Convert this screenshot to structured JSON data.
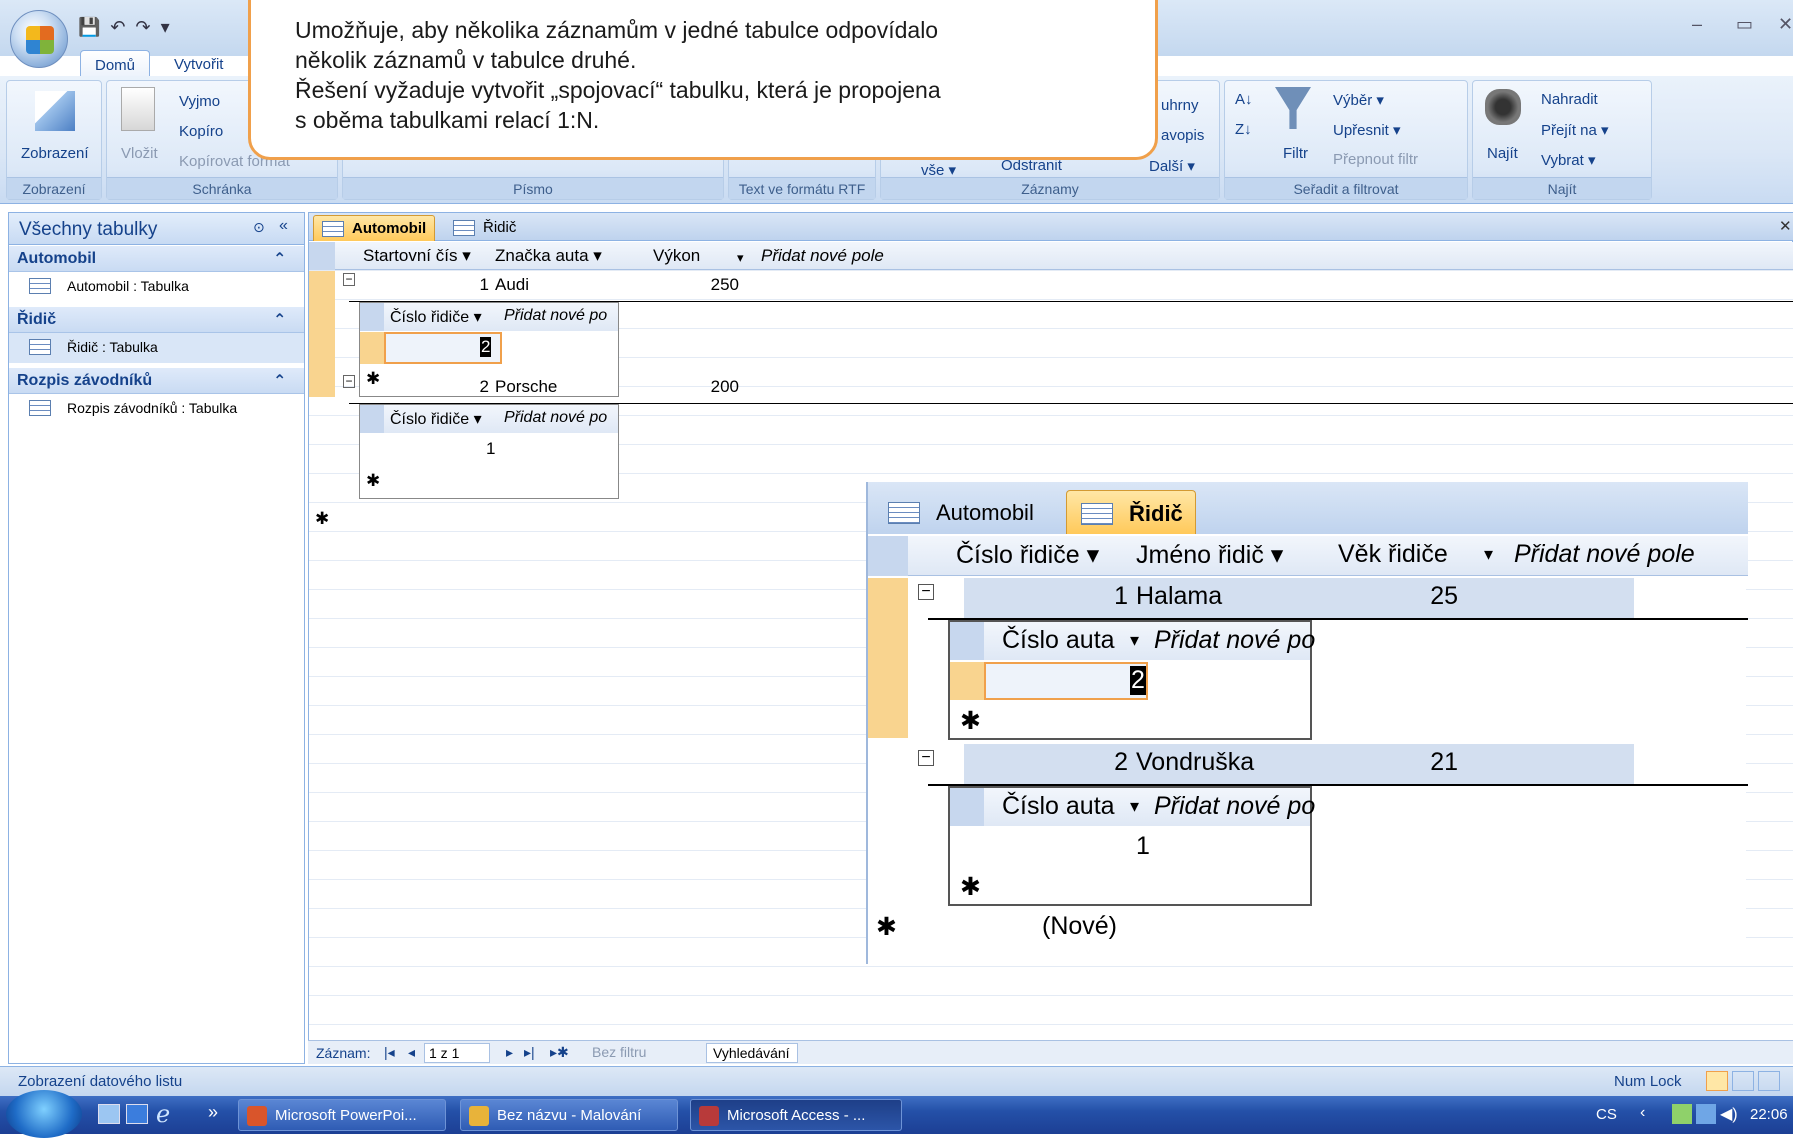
{
  "window": {
    "minimize": "–",
    "restore": "▭",
    "close": "✕"
  },
  "ribbon": {
    "tabs": [
      "Domů",
      "Vytvořit"
    ],
    "groups": {
      "zobrazeni": {
        "button": "Zobrazení",
        "label": "Zobrazení"
      },
      "schranka": {
        "paste": "Vložit",
        "cut": "Vyjmo",
        "copy": "Kopíro",
        "format_painter": "Kopírovat formát",
        "label": "Schránka"
      },
      "pismo": {
        "label": "Písmo"
      },
      "rtf": {
        "label": "Text ve formátu RTF"
      },
      "zaznamy": {
        "totals": "uhrny",
        "spelling": "avopis",
        "delete": "Odstranit",
        "more": "Další ▾",
        "all": "vše ▾",
        "label": "Záznamy"
      },
      "razeni": {
        "filter": "Filtr",
        "selection": "Výběr ▾",
        "advanced": "Upřesnit ▾",
        "toggle": "Přepnout filtr",
        "label": "Seřadit a filtrovat"
      },
      "najit": {
        "find": "Najít",
        "replace": "Nahradit",
        "goto": "Přejít na ▾",
        "select": "Vybrat ▾",
        "label": "Najít"
      }
    }
  },
  "callout": {
    "lines": [
      "Umožňuje, aby několika záznamům v jedné tabulce odpovídalo",
      "několik záznamů v tabulce druhé.",
      "Řešení vyžaduje vytvořit „spojovací“ tabulku, která je propojena",
      "s oběma tabulkami relací 1:N."
    ]
  },
  "nav_pane": {
    "title": "Všechny tabulky",
    "groups": [
      {
        "name": "Automobil",
        "item": "Automobil : Tabulka"
      },
      {
        "name": "Řidič",
        "item": "Řidič : Tabulka"
      },
      {
        "name": "Rozpis závodníků",
        "item": "Rozpis závodníků : Tabulka"
      }
    ]
  },
  "doc": {
    "tabs": [
      "Automobil",
      "Řidič"
    ],
    "headers": [
      "Startovní čís ▾",
      "Značka auta ▾",
      "Výkon",
      "▾",
      "Přidat nové pole"
    ],
    "rows": [
      {
        "id": "1",
        "brand": "Audi",
        "power": "250",
        "sub_header": [
          "Číslo řidiče ▾",
          "Přidat nové po"
        ],
        "sub_value": "2"
      },
      {
        "id": "2",
        "brand": "Porsche",
        "power": "200",
        "sub_header": [
          "Číslo řidiče ▾",
          "Přidat nové po"
        ],
        "sub_value": "1"
      }
    ],
    "new_row_marker": "✱"
  },
  "zoom": {
    "tabs": [
      "Automobil",
      "Řidič"
    ],
    "headers": [
      "Číslo řidiče ▾",
      "Jméno řidič ▾",
      "Věk řidiče",
      "▾",
      "Přidat nové pole"
    ],
    "rows": [
      {
        "id": "1",
        "name": "Halama",
        "age": "25",
        "sub_header": [
          "Číslo auta",
          "▾",
          "Přidat nové po"
        ],
        "sub_value": "2"
      },
      {
        "id": "2",
        "name": "Vondruška",
        "age": "21",
        "sub_header": [
          "Číslo auta",
          "▾",
          "Přidat nové po"
        ],
        "sub_value": "1"
      }
    ],
    "new_label": "(Nové)",
    "new_row_marker": "✱"
  },
  "record_nav": {
    "label": "Záznam:",
    "position": "1 z 1",
    "filter": "Bez filtru",
    "search": "Vyhledávání"
  },
  "status": {
    "left": "Zobrazení datového listu",
    "numlock": "Num Lock"
  },
  "taskbar": {
    "items": [
      "Microsoft PowerPoi...",
      "Bez názvu - Malování",
      "Microsoft Access - ..."
    ],
    "lang": "CS",
    "time": "22:06"
  }
}
